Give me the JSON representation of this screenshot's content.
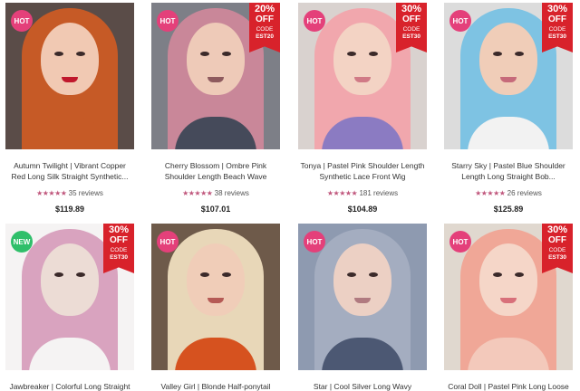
{
  "products": [
    {
      "title": "Autumn Twilight | Vibrant Copper Red Long Silk Straight Synthetic...",
      "stars": "★★★★★",
      "reviews": "35 reviews",
      "price": "$119.89",
      "badge": "HOT",
      "promo": null,
      "colors": {
        "bg": "#5a4c48",
        "hair": "#c65a26",
        "face": "#f1c9b3",
        "body": "#c65a26",
        "lip": "#c0172c"
      }
    },
    {
      "title": "Cherry Blossom | Ombre Pink Shoulder Length Beach Wave Synthetic...",
      "stars": "★★★★★",
      "reviews": "38 reviews",
      "price": "$107.01",
      "badge": "HOT",
      "promo": {
        "pct": "20%",
        "off": "OFF",
        "code_label": "CODE",
        "code": "EST20"
      },
      "colors": {
        "bg": "#7d7f87",
        "hair": "#c98799",
        "face": "#eecab8",
        "body": "#454a5a",
        "lip": "#8e5a5e"
      }
    },
    {
      "title": "Tonya | Pastel Pink Shoulder Length Synthetic Lace Front Wig",
      "stars": "★★★★★",
      "reviews": "181 reviews",
      "price": "$104.89",
      "badge": "HOT",
      "promo": {
        "pct": "30%",
        "off": "OFF",
        "code_label": "CODE",
        "code": "EST30"
      },
      "colors": {
        "bg": "#d9d2cf",
        "hair": "#f1a7ad",
        "face": "#f3d3c4",
        "body": "#8b7bc2",
        "lip": "#d07a86"
      }
    },
    {
      "title": "Starry Sky | Pastel Blue Shoulder Length Long Straight Bob...",
      "stars": "★★★★★",
      "reviews": "26 reviews",
      "price": "$125.89",
      "badge": "HOT",
      "promo": {
        "pct": "30%",
        "off": "OFF",
        "code_label": "CODE",
        "code": "EST30"
      },
      "colors": {
        "bg": "#dcdcdc",
        "hair": "#7ec3e3",
        "face": "#f0cdb8",
        "body": "#f2f2f2",
        "lip": "#c66a7a"
      }
    },
    {
      "title": "Jawbreaker | Colorful Long Straight Lace...",
      "stars": "",
      "reviews": "",
      "price": "",
      "badge": "NEW",
      "promo": {
        "pct": "30%",
        "off": "OFF",
        "code_label": "CODE",
        "code": "EST30"
      },
      "colors": {
        "bg": "#f5f3f3",
        "hair": "#d9a3bf",
        "face": "#ecdcd5",
        "body": "#f5f3f3",
        "lip": "#ecdcd5"
      }
    },
    {
      "title": "Valley Girl | Blonde Half-ponytail Long...",
      "stars": "",
      "reviews": "",
      "price": "",
      "badge": "HOT",
      "promo": null,
      "colors": {
        "bg": "#6e5a4a",
        "hair": "#e8d7b8",
        "face": "#f0cdb8",
        "body": "#d6521f",
        "lip": "#b55a55"
      }
    },
    {
      "title": "Star | Cool Silver Long Wavy Synthetic Lace...",
      "stars": "",
      "reviews": "",
      "price": "",
      "badge": "HOT",
      "promo": null,
      "colors": {
        "bg": "#8e9ab0",
        "hair": "#a4adc0",
        "face": "#ecd0c4",
        "body": "#4c5873",
        "lip": "#b07a80"
      }
    },
    {
      "title": "Coral Doll | Pastel Pink Long Loose Curl...",
      "stars": "",
      "reviews": "",
      "price": "",
      "badge": "HOT",
      "promo": {
        "pct": "30%",
        "off": "OFF",
        "code_label": "CODE",
        "code": "EST30"
      },
      "colors": {
        "bg": "#e0d8cf",
        "hair": "#f0a797",
        "face": "#f5d6c8",
        "body": "#f3c9bb",
        "lip": "#d8707a"
      }
    }
  ]
}
